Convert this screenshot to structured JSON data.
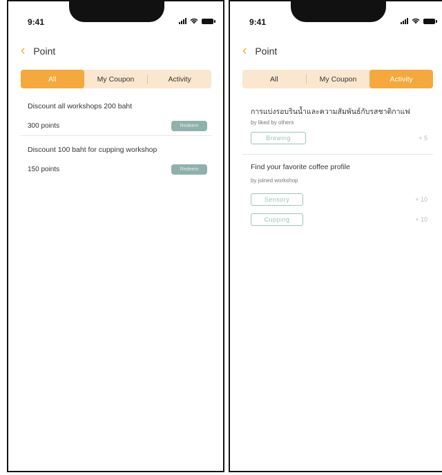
{
  "status": {
    "time": "9:41"
  },
  "header": {
    "title": "Point"
  },
  "tabs": [
    {
      "label": "All"
    },
    {
      "label": "My Coupon"
    },
    {
      "label": "Activity"
    }
  ],
  "left_screen": {
    "active_tab": "All",
    "coupons": [
      {
        "title": "Discount all workshops 200 baht",
        "points": "300 points",
        "button": "Redeem"
      },
      {
        "title": "Discount 100 baht for cupping workshop",
        "points": "150 points",
        "button": "Redeem"
      }
    ]
  },
  "right_screen": {
    "active_tab": "Activity",
    "activities": [
      {
        "title": "การแบ่งรอบรินน้ำและความสัมพันธ์กับรสชาติกาแฟ",
        "subtitle": "by liked by others",
        "items": [
          {
            "tag": "Brewing",
            "points": "+ 5"
          }
        ]
      },
      {
        "title": "Find your favorite coffee profile",
        "subtitle": "by joined workshop",
        "items": [
          {
            "tag": "Sensory",
            "points": "+ 10"
          },
          {
            "tag": "Cupping",
            "points": "+ 10"
          }
        ]
      }
    ]
  },
  "colors": {
    "accent": "#f5a83c",
    "tab_bg": "#fbe7cf",
    "redeem": "#8fb1ab",
    "tag": "#9cc4bb"
  },
  "icons": [
    "back-chevron-icon",
    "signal-icon",
    "wifi-icon",
    "battery-icon"
  ]
}
